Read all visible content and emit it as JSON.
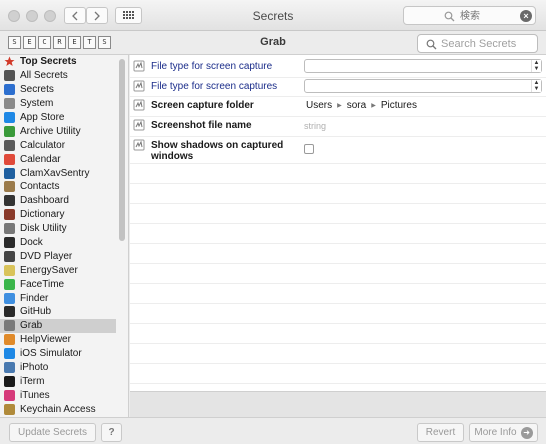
{
  "window": {
    "title": "Secrets"
  },
  "titlebar": {
    "search_placeholder": "検索"
  },
  "subbar": {
    "section_title": "Grab",
    "search_placeholder": "Search Secrets",
    "logo_letters": [
      "S",
      "E",
      "C",
      "R",
      "E",
      "T",
      "S"
    ]
  },
  "sidebar": {
    "items": [
      {
        "label": "Top Secrets",
        "icon": "top-secrets-icon",
        "color": "#d23a2a",
        "bold": true
      },
      {
        "label": "All Secrets",
        "icon": "all-secrets-icon",
        "color": "#555555"
      },
      {
        "label": "Secrets",
        "icon": "secrets-icon",
        "color": "#2d6fcf"
      },
      {
        "label": "System",
        "icon": "system-icon",
        "color": "#8a8a8a"
      },
      {
        "label": "App Store",
        "icon": "app-store-icon",
        "color": "#1e88e5"
      },
      {
        "label": "Archive Utility",
        "icon": "archive-utility-icon",
        "color": "#3a9a3a"
      },
      {
        "label": "Calculator",
        "icon": "calculator-icon",
        "color": "#5a5a5a"
      },
      {
        "label": "Calendar",
        "icon": "calendar-icon",
        "color": "#e04a3a"
      },
      {
        "label": "ClamXavSentry",
        "icon": "clamxav-icon",
        "color": "#1f5f9f"
      },
      {
        "label": "Contacts",
        "icon": "contacts-icon",
        "color": "#9a7a4a"
      },
      {
        "label": "Dashboard",
        "icon": "dashboard-icon",
        "color": "#333333"
      },
      {
        "label": "Dictionary",
        "icon": "dictionary-icon",
        "color": "#8a3a2a"
      },
      {
        "label": "Disk Utility",
        "icon": "disk-utility-icon",
        "color": "#777777"
      },
      {
        "label": "Dock",
        "icon": "dock-icon",
        "color": "#2a2a2a"
      },
      {
        "label": "DVD Player",
        "icon": "dvd-player-icon",
        "color": "#444444"
      },
      {
        "label": "EnergySaver",
        "icon": "energy-saver-icon",
        "color": "#d9c35a"
      },
      {
        "label": "FaceTime",
        "icon": "facetime-icon",
        "color": "#3ab54a"
      },
      {
        "label": "Finder",
        "icon": "finder-icon",
        "color": "#3f8fe0"
      },
      {
        "label": "GitHub",
        "icon": "github-icon",
        "color": "#2a2a2a"
      },
      {
        "label": "Grab",
        "icon": "grab-icon",
        "color": "#7a7a7a",
        "selected": true
      },
      {
        "label": "HelpViewer",
        "icon": "help-viewer-icon",
        "color": "#e08a2a"
      },
      {
        "label": "iOS Simulator",
        "icon": "ios-simulator-icon",
        "color": "#1e88e5"
      },
      {
        "label": "iPhoto",
        "icon": "iphoto-icon",
        "color": "#4a7ab0"
      },
      {
        "label": "iTerm",
        "icon": "iterm-icon",
        "color": "#1a1a1a"
      },
      {
        "label": "iTunes",
        "icon": "itunes-icon",
        "color": "#d63a7a"
      },
      {
        "label": "Keychain Access",
        "icon": "keychain-access-icon",
        "color": "#b08a3a"
      }
    ]
  },
  "settings": [
    {
      "label": "File type for screen capture",
      "style": "blue",
      "control": "popup",
      "value": ""
    },
    {
      "label": "File type for screen captures",
      "style": "blue",
      "control": "popup",
      "value": ""
    },
    {
      "label": "Screen capture folder",
      "style": "bold",
      "control": "path",
      "path": [
        "Users",
        "sora",
        "Pictures"
      ]
    },
    {
      "label": "Screenshot file name",
      "style": "bold",
      "control": "text",
      "placeholder": "string"
    },
    {
      "label": "Show shadows on captured windows",
      "style": "bold",
      "control": "checkbox",
      "checked": false
    }
  ],
  "bottom": {
    "update_label": "Update Secrets",
    "help_label": "?",
    "revert_label": "Revert",
    "more_info_label": "More Info"
  }
}
